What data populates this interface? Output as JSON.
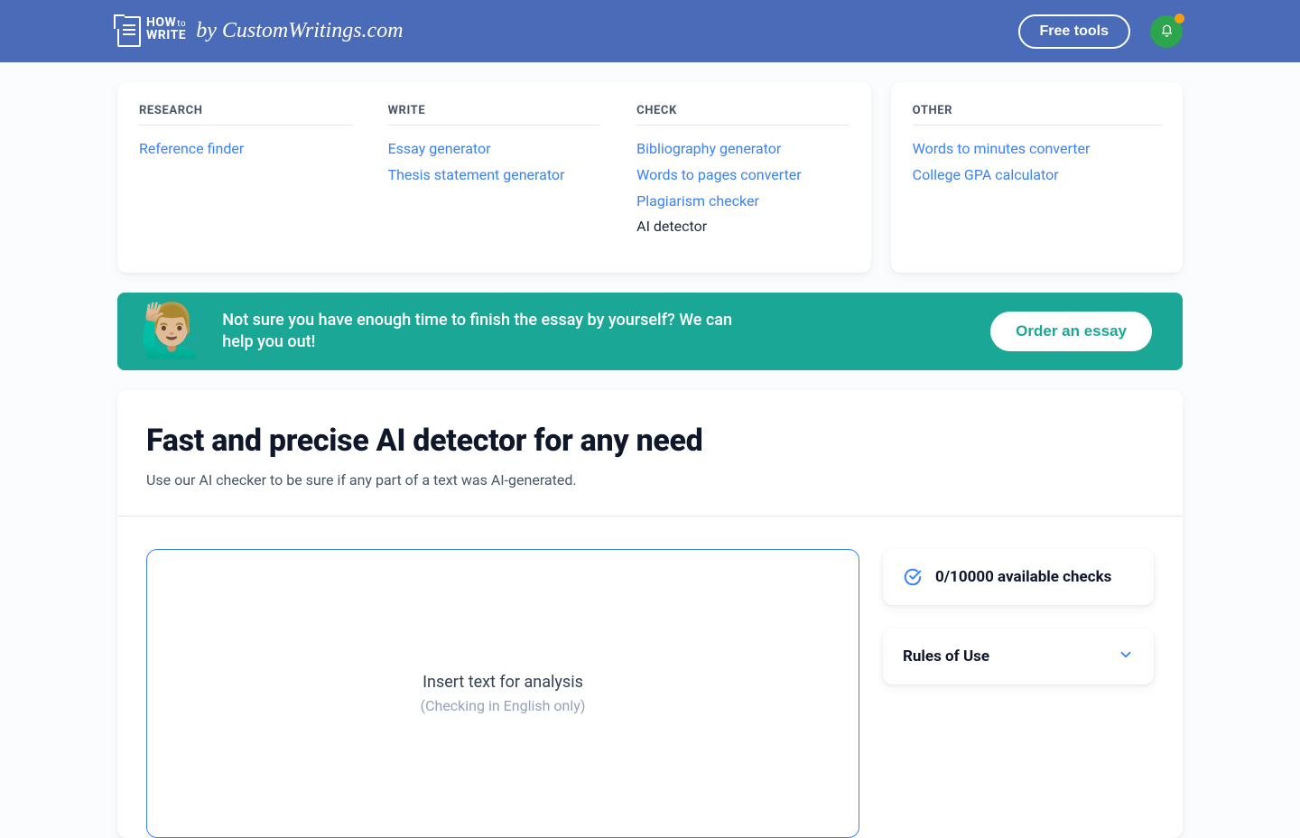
{
  "header": {
    "logo_line1": "HOW",
    "logo_small": "to",
    "logo_line2": "WRITE",
    "brand": "by CustomWritings.com",
    "free_tools": "Free tools"
  },
  "tools": {
    "research": {
      "heading": "RESEARCH",
      "items": [
        "Reference finder"
      ]
    },
    "write": {
      "heading": "WRITE",
      "items": [
        "Essay generator",
        "Thesis statement generator"
      ]
    },
    "check": {
      "heading": "CHECK",
      "items": [
        "Bibliography generator",
        "Words to pages converter",
        "Plagiarism checker"
      ],
      "active": "AI detector"
    },
    "other": {
      "heading": "OTHER",
      "items": [
        "Words to minutes converter",
        "College GPA calculator"
      ]
    }
  },
  "promo": {
    "emoji": "🙋🏼‍♂️",
    "text": "Not sure you have enough time to finish the essay by yourself? We can help you out!",
    "button": "Order an essay"
  },
  "tool": {
    "title": "Fast and precise AI detector for any need",
    "subtitle": "Use our AI checker to be sure if any part of a text was AI-generated.",
    "placeholder_main": "Insert text for analysis",
    "placeholder_sub": "(Checking in English only)"
  },
  "side": {
    "checks": "0/10000 available checks",
    "rules": "Rules of Use"
  }
}
